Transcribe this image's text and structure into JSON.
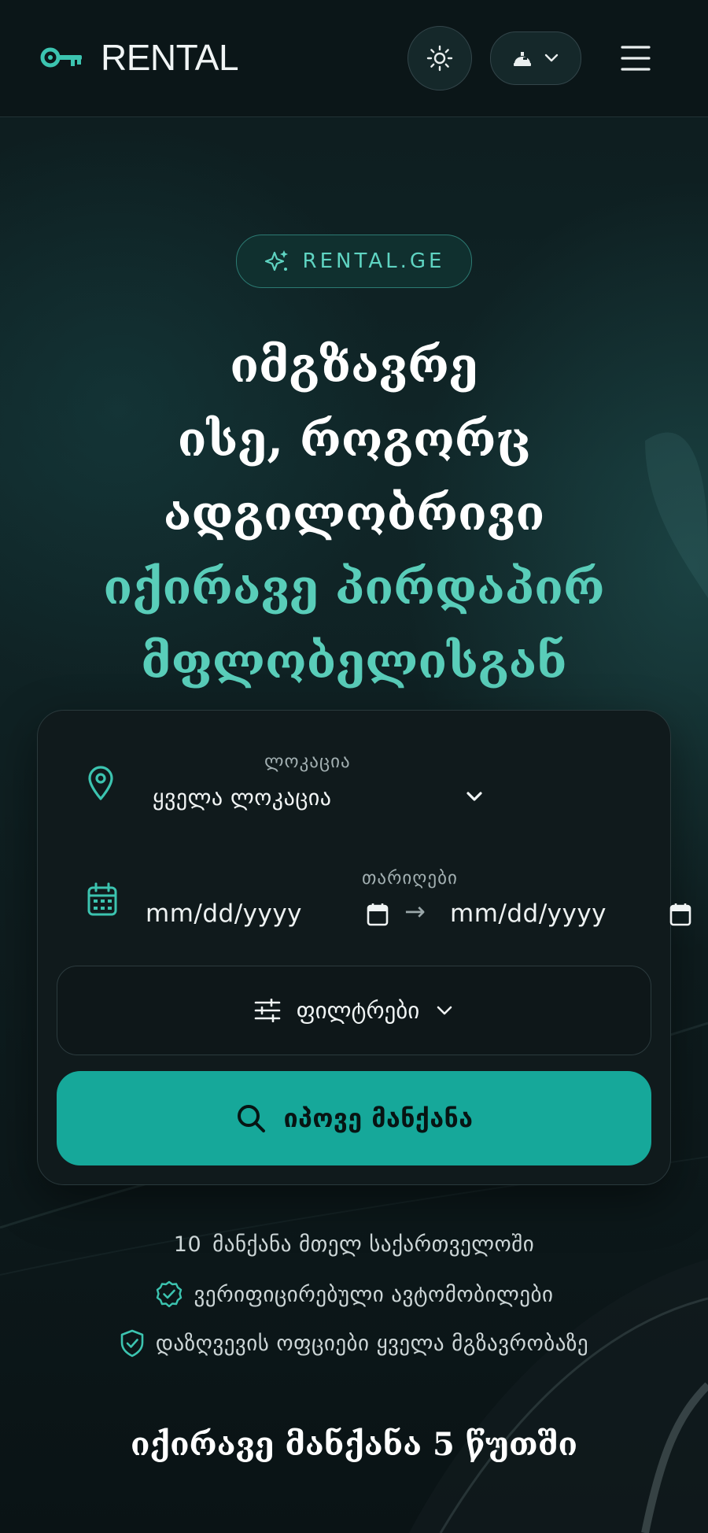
{
  "header": {
    "brand": "RENTAL",
    "theme_icon": "sun-icon",
    "lang_icon": "globe-icon",
    "menu_icon": "hamburger-icon"
  },
  "hero": {
    "badge": "RENTAL.GE",
    "title_lines": [
      "იმგზავრე",
      "ისე, როგორც",
      "ადგილობრივი"
    ],
    "accent_lines": [
      "იქირავე პირდაპირ",
      "მფლობელისგან"
    ]
  },
  "search": {
    "location_label": "ლოკაცია",
    "location_value": "ყველა ლოკაცია",
    "dates_label": "თარიღები",
    "date_from_placeholder": "mm/dd/yyyy",
    "date_to_placeholder": "mm/dd/yyyy",
    "arrow": "→",
    "filters_label": "ფილტრები",
    "submit_label": "იპოვე მანქანა"
  },
  "features": {
    "count": "10",
    "count_text": "მანქანა მთელ საქართველოში",
    "verified": "ვერიფიცირებული ავტომობილები",
    "insurance": "დაზღვევის ოფციები ყველა მგზავრობაზე"
  },
  "bottom": {
    "title": "იქირავე მანქანა 5 წუთში"
  },
  "colors": {
    "accent": "#59cdb9",
    "button": "#16a89a",
    "background": "#0b1517"
  }
}
